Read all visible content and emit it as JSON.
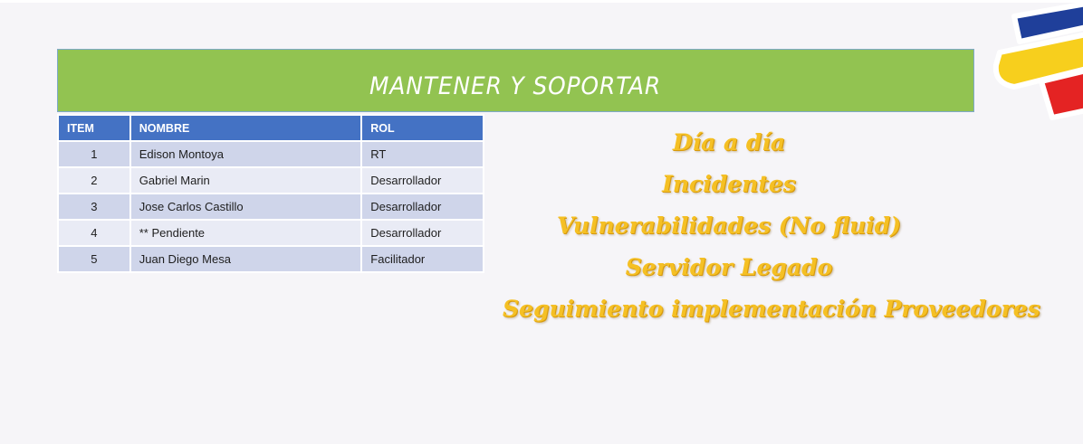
{
  "banner": {
    "title": "MANTENER Y SOPORTAR"
  },
  "table": {
    "headers": {
      "item": "ITEM",
      "nombre": "NOMBRE",
      "rol": "ROL"
    },
    "rows": [
      {
        "item": "1",
        "nombre": "Edison Montoya",
        "rol": "RT"
      },
      {
        "item": "2",
        "nombre": "Gabriel Marin",
        "rol": "Desarrollador"
      },
      {
        "item": "3",
        "nombre": "Jose Carlos Castillo",
        "rol": "Desarrollador"
      },
      {
        "item": "4",
        "nombre": "** Pendiente",
        "rol": "Desarrollador"
      },
      {
        "item": "5",
        "nombre": "Juan Diego Mesa",
        "rol": "Facilitador"
      }
    ]
  },
  "activities": [
    "Día a día",
    "Incidentes",
    "Vulnerabilidades (No fluid)",
    "Servidor Legado",
    "Seguimiento implementación Proveedores"
  ],
  "colors": {
    "banner": "#92c351",
    "table_header": "#4472c4",
    "row_odd": "#cfd5ea",
    "row_even": "#e9ebf5",
    "activity_text": "#f5c024",
    "logo_blue": "#1f3f9a",
    "logo_yellow": "#f7cf1d",
    "logo_red": "#e42323"
  }
}
